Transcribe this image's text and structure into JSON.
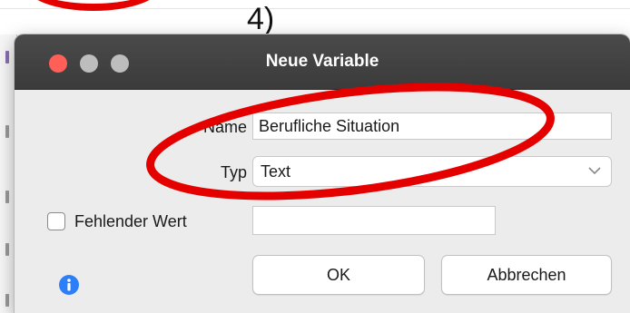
{
  "annotation": {
    "step_label": "4)",
    "highlight_color": "#e50000"
  },
  "dialog": {
    "title": "Neue Variable",
    "window_controls": {
      "close": "close-icon",
      "minimize": "minimize-icon",
      "zoom": "zoom-icon",
      "close_color": "#ff5f57",
      "inactive_color": "#bdbdbd"
    },
    "name_label": "Name",
    "name_value": "Berufliche Situation",
    "type_label": "Typ",
    "type_value": "Text",
    "missing_value_checked": false,
    "missing_value_label": "Fehlender Wert",
    "missing_value_input": "",
    "info_icon": "info-icon",
    "info_color": "#2d7ff9",
    "ok_label": "OK",
    "cancel_label": "Abbrechen"
  }
}
